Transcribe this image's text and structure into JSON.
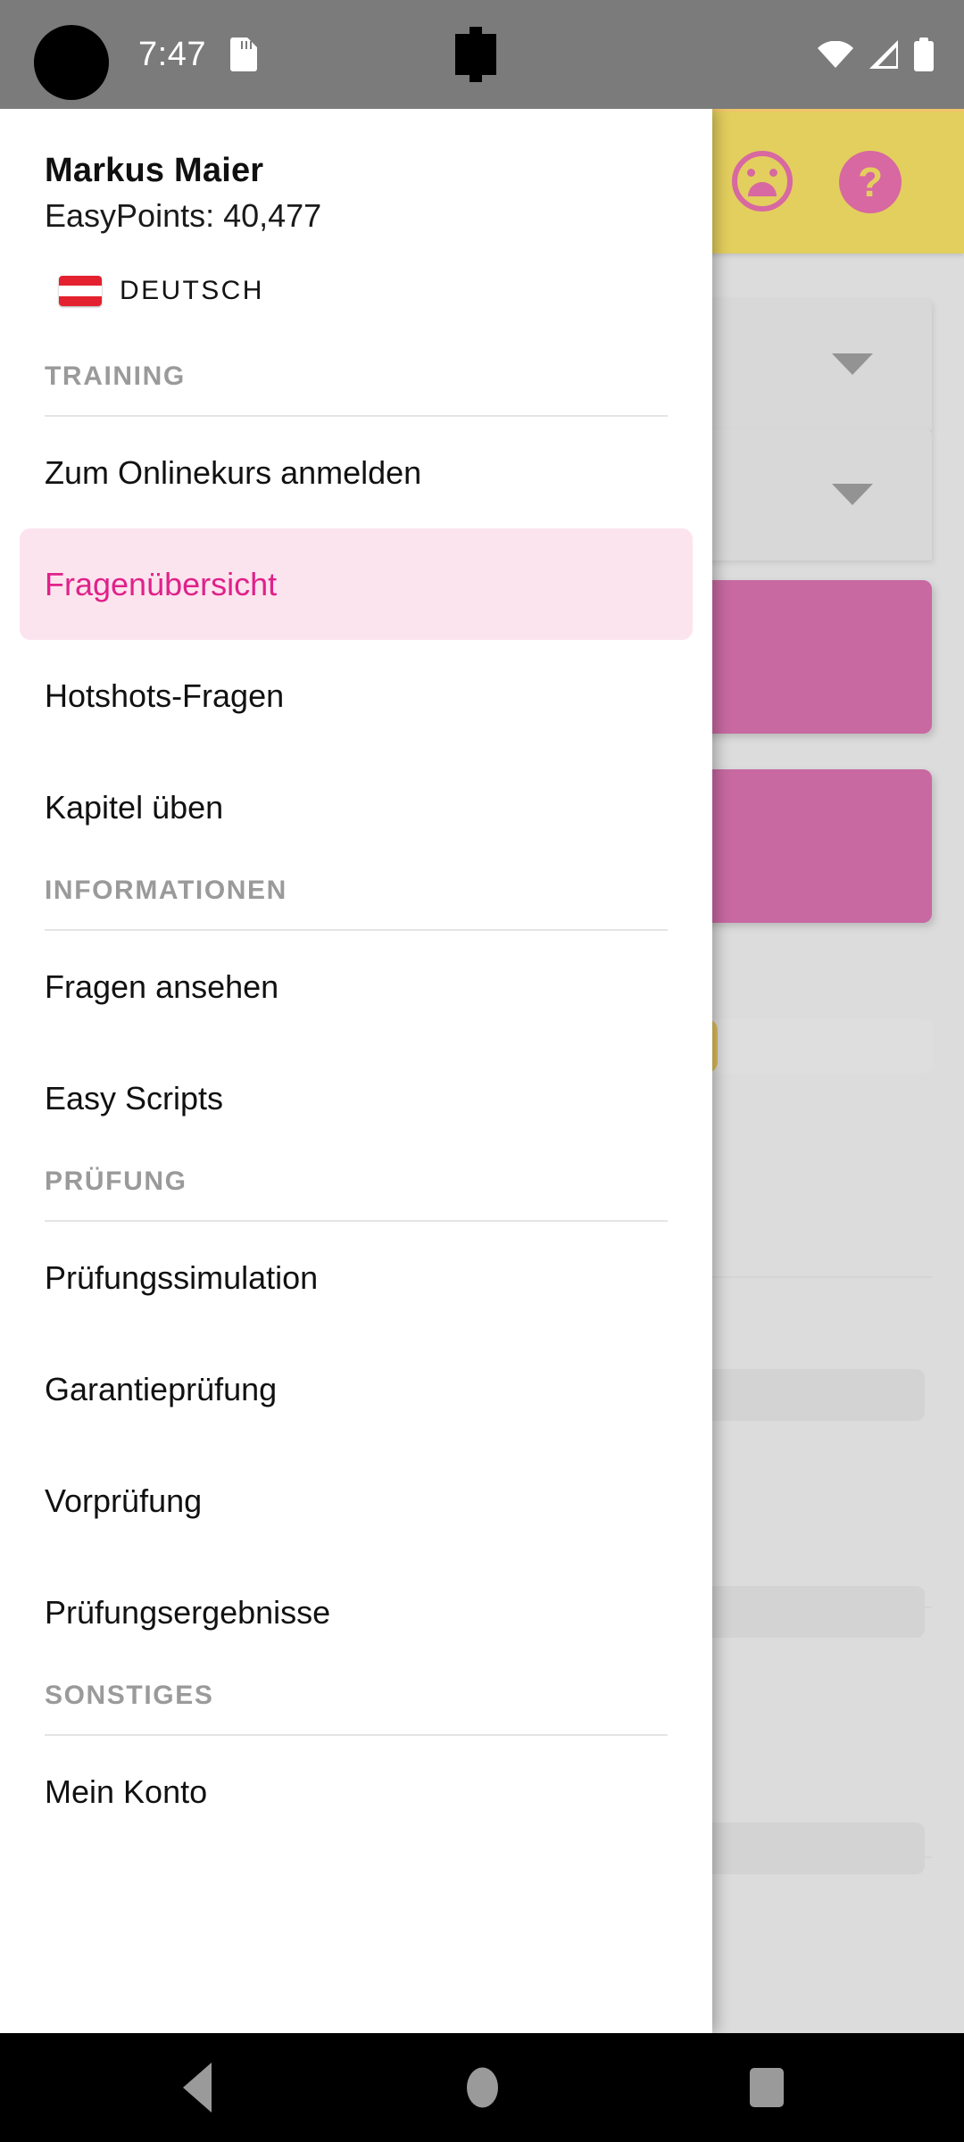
{
  "status_bar": {
    "time": "7:47",
    "icons": [
      "sd-card-icon",
      "notification-icon",
      "wifi-icon",
      "cellular-signal-icon",
      "battery-icon"
    ]
  },
  "app_toolbar": {
    "background_color": "#d4b508",
    "sad_face_icon": "sad-face-icon",
    "help_label": "?"
  },
  "drawer": {
    "user_name": "Markus Maier",
    "points_label": "EasyPoints: 40,477",
    "language": {
      "flag": "austria-flag-icon",
      "label": "DEUTSCH"
    },
    "accent_color": "#e0218a",
    "highlight_bg": "#fce4ee",
    "sections": [
      {
        "title": "TRAINING",
        "items": [
          {
            "label": "Zum Onlinekurs anmelden",
            "selected": false
          },
          {
            "label": "Fragenübersicht",
            "selected": true
          },
          {
            "label": "Hotshots-Fragen",
            "selected": false
          },
          {
            "label": "Kapitel üben",
            "selected": false
          }
        ]
      },
      {
        "title": "INFORMATIONEN",
        "items": [
          {
            "label": "Fragen ansehen",
            "selected": false
          },
          {
            "label": "Easy Scripts",
            "selected": false
          }
        ]
      },
      {
        "title": "PRÜFUNG",
        "items": [
          {
            "label": "Prüfungssimulation",
            "selected": false
          },
          {
            "label": "Garantieprüfung",
            "selected": false
          },
          {
            "label": "Vorprüfung",
            "selected": false
          },
          {
            "label": "Prüfungsergebnisse",
            "selected": false
          }
        ]
      },
      {
        "title": "SONSTIGES",
        "items": [
          {
            "label": "Mein Konto",
            "selected": false
          }
        ]
      }
    ]
  },
  "background_content": {
    "card_color": "#ab1a70",
    "progress_color": "#cc9f05",
    "progress_percent": 76,
    "spinner_count": 2,
    "card_count": 2
  },
  "nav_bar": {
    "back": "back-triangle-icon",
    "home": "home-circle-icon",
    "recents": "recents-square-icon"
  }
}
